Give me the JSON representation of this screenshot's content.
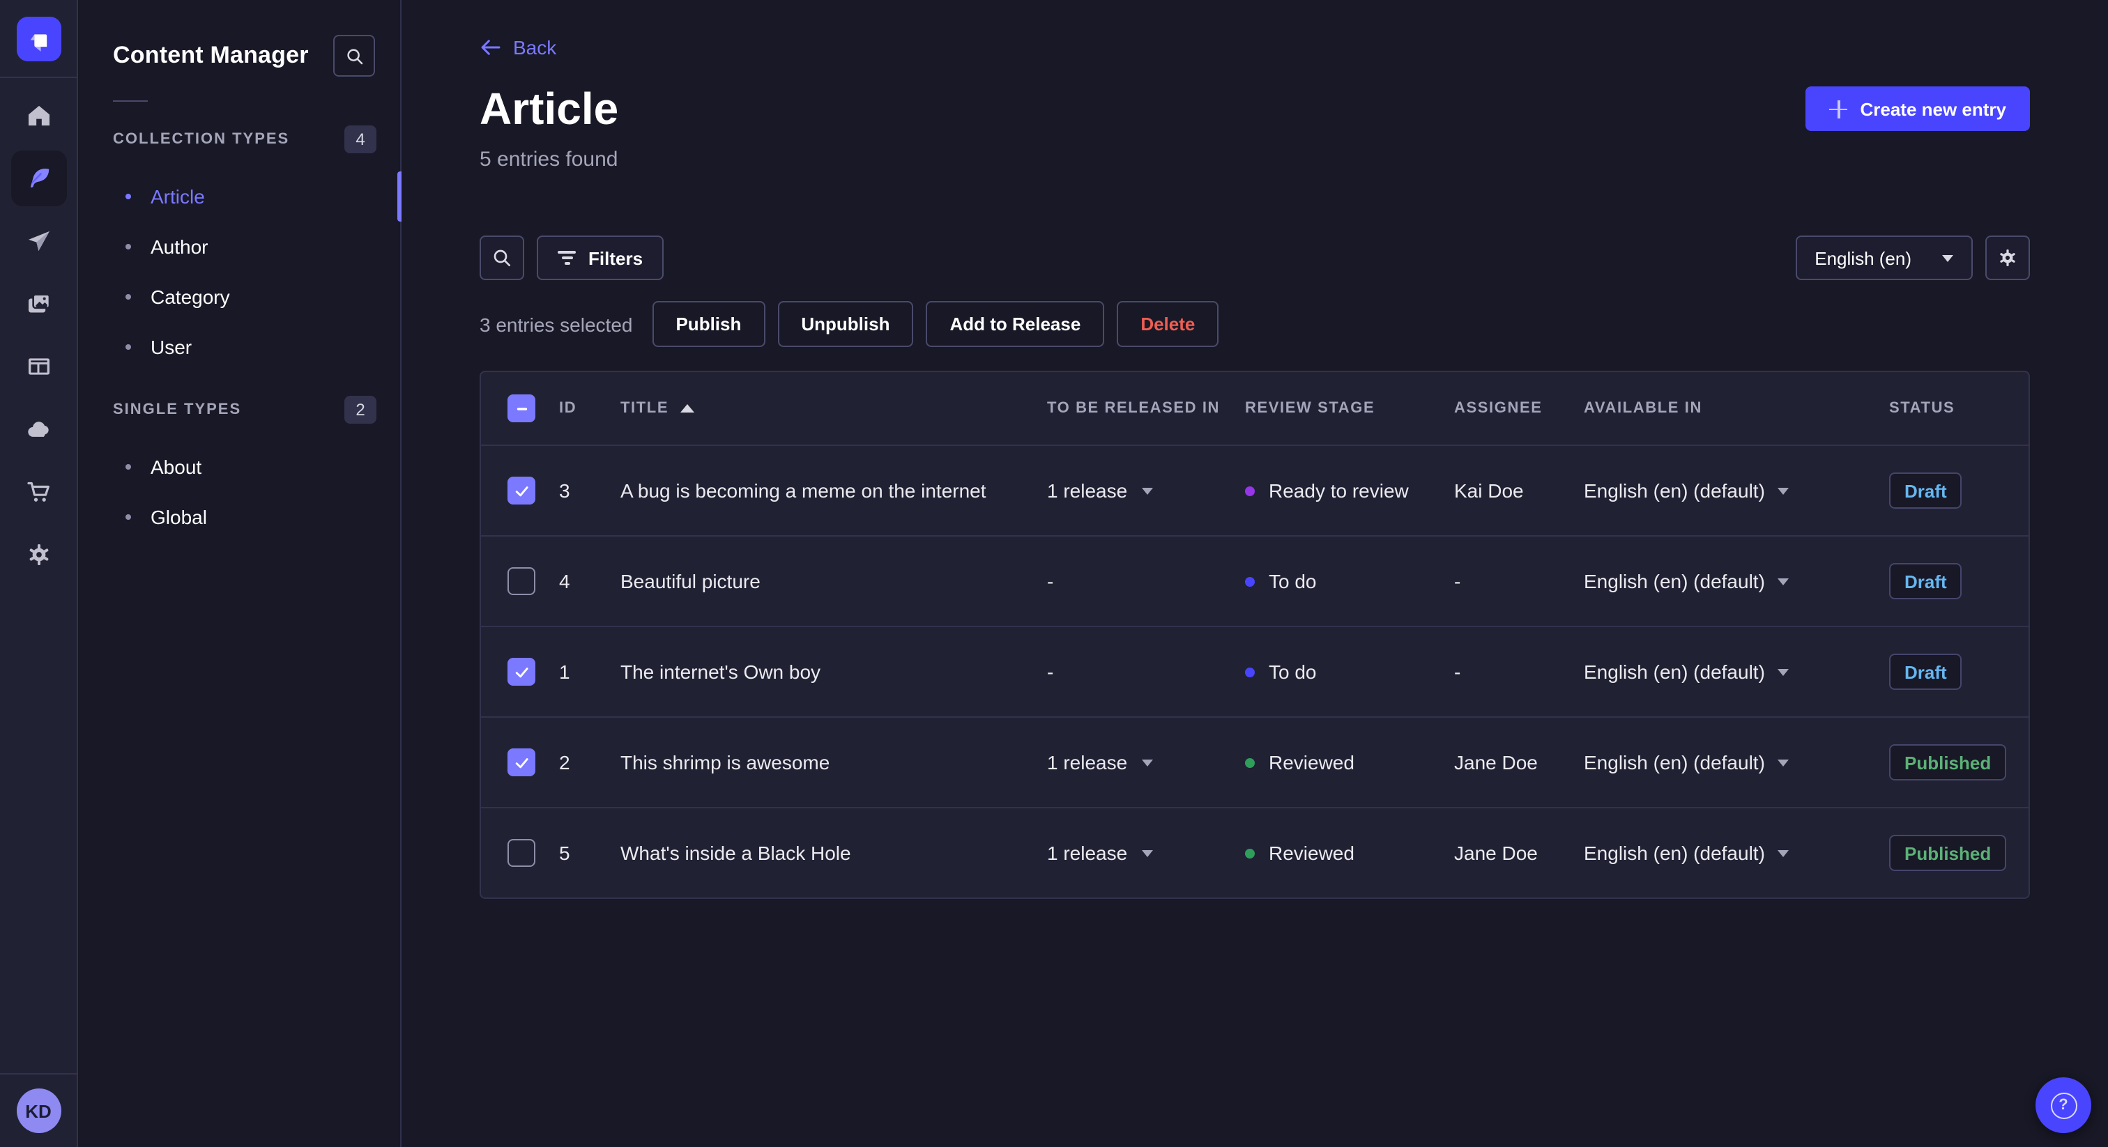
{
  "sidebar": {
    "title": "Content Manager",
    "sections": [
      {
        "label": "COLLECTION TYPES",
        "count": "4",
        "items": [
          {
            "label": "Article",
            "active": true
          },
          {
            "label": "Author",
            "active": false
          },
          {
            "label": "Category",
            "active": false
          },
          {
            "label": "User",
            "active": false
          }
        ]
      },
      {
        "label": "SINGLE TYPES",
        "count": "2",
        "items": [
          {
            "label": "About",
            "active": false
          },
          {
            "label": "Global",
            "active": false
          }
        ]
      }
    ]
  },
  "rail": {
    "avatar_initials": "KD"
  },
  "header": {
    "back_label": "Back",
    "title": "Article",
    "subtitle": "5 entries found",
    "create_button_label": "Create new entry"
  },
  "toolbar": {
    "filters_label": "Filters",
    "locale_selected": "English (en)"
  },
  "selection": {
    "text": "3 entries selected",
    "actions": [
      {
        "label": "Publish",
        "danger": false
      },
      {
        "label": "Unpublish",
        "danger": false
      },
      {
        "label": "Add to Release",
        "danger": false
      },
      {
        "label": "Delete",
        "danger": true
      }
    ]
  },
  "table": {
    "columns": {
      "id": "ID",
      "title": "TITLE",
      "released": "TO BE RELEASED IN",
      "stage": "REVIEW STAGE",
      "assignee": "ASSIGNEE",
      "available": "AVAILABLE IN",
      "status": "STATUS"
    },
    "sort": {
      "column": "TITLE",
      "direction": "asc"
    },
    "header_checkbox_state": "indeterminate",
    "rows": [
      {
        "checked": true,
        "id": "3",
        "title": "A bug is becoming a meme on the internet",
        "released": "1 release",
        "stage": "Ready to review",
        "stage_color": "#9736e8",
        "assignee": "Kai Doe",
        "available": "English (en) (default)",
        "status": "Draft",
        "status_color": "#66b7f1"
      },
      {
        "checked": false,
        "id": "4",
        "title": "Beautiful picture",
        "released": "-",
        "stage": "To do",
        "stage_color": "#4945ff",
        "assignee": "-",
        "available": "English (en) (default)",
        "status": "Draft",
        "status_color": "#66b7f1"
      },
      {
        "checked": true,
        "id": "1",
        "title": "The internet's Own boy",
        "released": "-",
        "stage": "To do",
        "stage_color": "#4945ff",
        "assignee": "-",
        "available": "English (en) (default)",
        "status": "Draft",
        "status_color": "#66b7f1"
      },
      {
        "checked": true,
        "id": "2",
        "title": "This shrimp is awesome",
        "released": "1 release",
        "stage": "Reviewed",
        "stage_color": "#2f9e5b",
        "assignee": "Jane Doe",
        "available": "English (en) (default)",
        "status": "Published",
        "status_color": "#5cb176"
      },
      {
        "checked": false,
        "id": "5",
        "title": "What's inside a Black Hole",
        "released": "1 release",
        "stage": "Reviewed",
        "stage_color": "#2f9e5b",
        "assignee": "Jane Doe",
        "available": "English (en) (default)",
        "status": "Published",
        "status_color": "#5cb176"
      }
    ]
  },
  "colors": {
    "background": "#181826",
    "surface": "#212134",
    "border": "#32324d",
    "primary": "#4945ff",
    "primary_light": "#7b79ff",
    "muted_text": "#a5a5ba",
    "draft_text": "#66b7f1",
    "published_text": "#5cb176",
    "danger_text": "#ee5e52",
    "stage_todo": "#4945ff",
    "stage_ready_to_review": "#9736e8",
    "stage_reviewed": "#2f9e5b"
  }
}
